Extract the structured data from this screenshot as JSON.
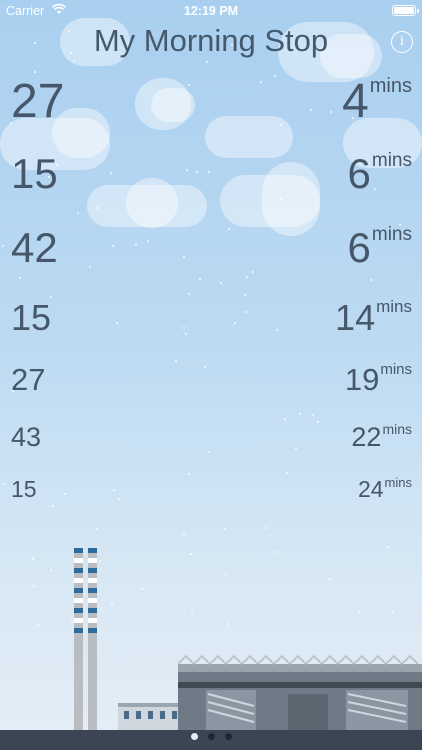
{
  "status_bar": {
    "carrier": "Carrier",
    "time": "12:19 PM",
    "battery_level": 1.0
  },
  "header": {
    "title": "My Morning Stop",
    "info_label": "i"
  },
  "departures": [
    {
      "route": "27",
      "minutes": "4",
      "unit": "mins"
    },
    {
      "route": "15",
      "minutes": "6",
      "unit": "mins"
    },
    {
      "route": "42",
      "minutes": "6",
      "unit": "mins"
    },
    {
      "route": "15",
      "minutes": "14",
      "unit": "mins"
    },
    {
      "route": "27",
      "minutes": "19",
      "unit": "mins"
    },
    {
      "route": "43",
      "minutes": "22",
      "unit": "mins"
    },
    {
      "route": "15",
      "minutes": "24",
      "unit": "mins"
    }
  ],
  "pager": {
    "pages": 3,
    "current": 1
  },
  "colors": {
    "sky_top": "#a9cff0",
    "sky_bottom": "#e4eef6",
    "text": "#46576a",
    "ground": "#3b4553",
    "chimney_stripe": "#2e6a9a"
  }
}
